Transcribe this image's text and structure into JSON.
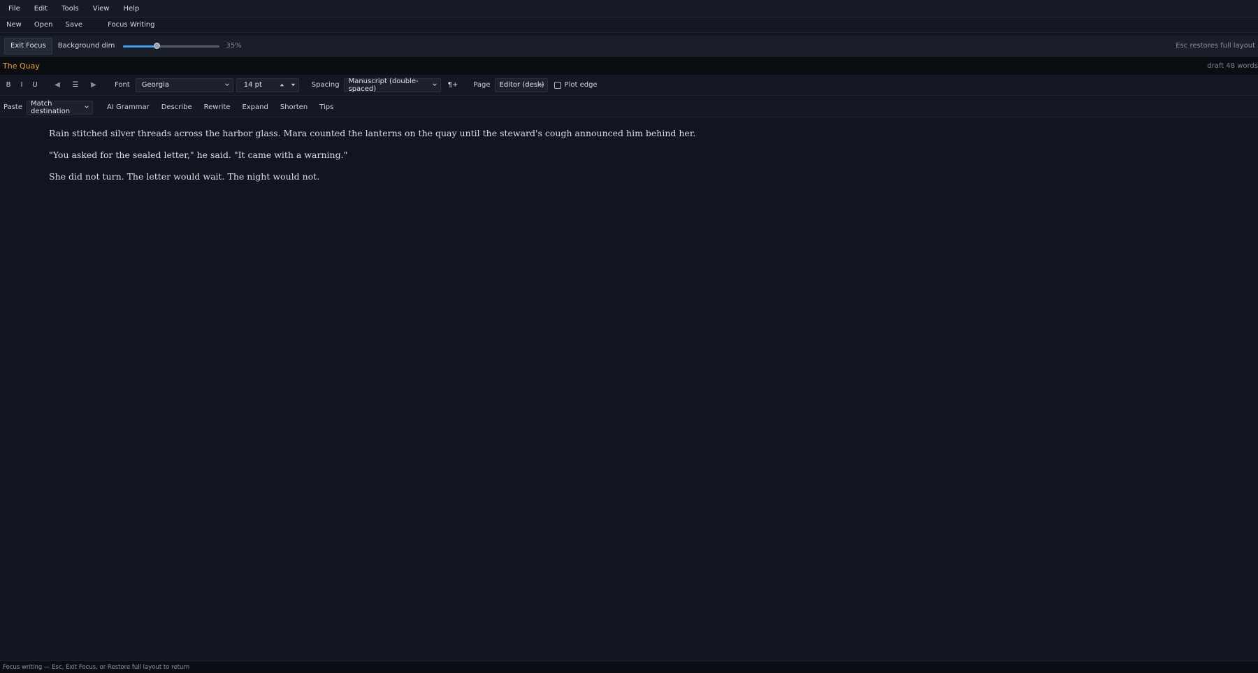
{
  "menubar": {
    "items": [
      "File",
      "Edit",
      "Tools",
      "View",
      "Help"
    ]
  },
  "quickbar": {
    "new": "New",
    "open": "Open",
    "save": "Save",
    "focus_writing": "Focus Writing"
  },
  "focusbar": {
    "exit_focus": "Exit Focus",
    "background_dim_label": "Background dim",
    "background_dim_value": 0.35,
    "background_dim_text": "35%",
    "esc_hint": "Esc restores full layout",
    "accent_color": "#3ea0e8"
  },
  "document": {
    "title": "The Quay",
    "status": "draft 48 words",
    "title_color": "#e3a24e"
  },
  "format": {
    "bold": "B",
    "italic": "I",
    "underline": "U",
    "align_left": "◀",
    "align_center": "☰",
    "align_right": "▶",
    "font_label": "Font",
    "font_value": "Georgia",
    "size_value": "14 pt",
    "spacing_label": "Spacing",
    "spacing_value": "Manuscript (double-spaced)",
    "paragraph_icon": "¶+",
    "page_label": "Page",
    "page_value": "Editor (desk)",
    "plot_edge_label": "Plot edge",
    "plot_edge_checked": false
  },
  "ai": {
    "paste": "Paste",
    "paste_mode": "Match destination",
    "grammar": "AI Grammar",
    "describe": "Describe",
    "rewrite": "Rewrite",
    "expand": "Expand",
    "shorten": "Shorten",
    "tips": "Tips"
  },
  "editor": {
    "paragraphs": [
      "Rain stitched silver threads across the harbor glass. Mara counted the lanterns on the quay until the steward's cough announced him behind her.",
      "\"You asked for the sealed letter,\" he said. \"It came with a warning.\"",
      "She did not turn. The letter would wait. The night would not."
    ]
  },
  "status": {
    "text": "Focus writing — Esc, Exit Focus, or Restore full layout to return"
  }
}
